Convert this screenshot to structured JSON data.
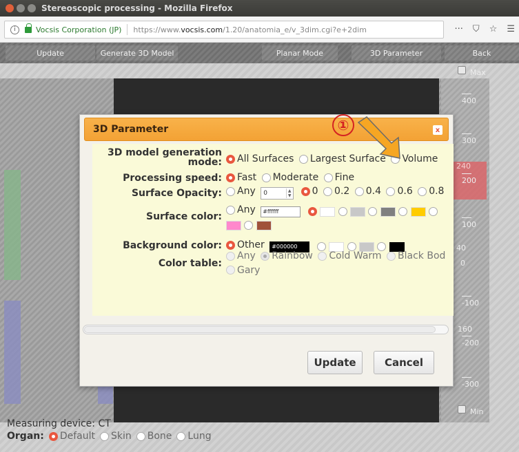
{
  "window": {
    "title": "Stereoscopic processing - Mozilla Firefox"
  },
  "urlbar": {
    "site_identity": "Vocsis Corporation (JP)",
    "url_prefix": "https://www.",
    "url_domain": "vocsis.com",
    "url_path": "/1.20/anatomia_e/v_3dim.cgi?e+2dim",
    "more_icon": "···"
  },
  "toolbar": {
    "update": "Update",
    "generate": "Generate 3D Model",
    "planar": "Planar Mode",
    "parameter": "3D Parameter",
    "back": "Back"
  },
  "ruler": {
    "max": "Max",
    "min": "Min",
    "labels": [
      "400",
      "300",
      "200",
      "100",
      "0",
      "-100",
      "-200",
      "-300"
    ],
    "side_labels": [
      "240",
      "40",
      "160"
    ]
  },
  "footer": {
    "measuring": "Measuring device: CT",
    "organ_label": "Organ:",
    "organs": [
      "Default",
      "Skin",
      "Bone",
      "Lung"
    ]
  },
  "annotation": {
    "number": "①"
  },
  "dialog": {
    "title": "3D Parameter",
    "close": "x",
    "generation": {
      "label_line1": "3D model generation",
      "label_line2": "mode:",
      "options": [
        "All Surfaces",
        "Largest Surface",
        "Volume"
      ]
    },
    "speed": {
      "label": "Processing speed:",
      "options": [
        "Fast",
        "Moderate",
        "Fine"
      ]
    },
    "opacity": {
      "label": "Surface Opacity:",
      "any": "Any",
      "input_value": "0",
      "options": [
        "0",
        "0.2",
        "0.4",
        "0.6",
        "0.8"
      ]
    },
    "surface_color": {
      "label": "Surface color:",
      "any": "Any",
      "input_value": "#ffffff",
      "swatches": [
        "#ffffff",
        "#c8c8c8",
        "#808080",
        "#ffcc00",
        "#ff88cc",
        "#a0523a"
      ]
    },
    "background_color": {
      "label": "Background color:",
      "other": "Other",
      "input_value": "#000000",
      "swatches": [
        "#ffffff",
        "#c8c8c8",
        "#000000"
      ]
    },
    "color_table": {
      "label": "Color table:",
      "options": [
        "Any",
        "Rainbow",
        "Cold Warm",
        "Black Bod",
        "Gary"
      ]
    },
    "update_button": "Update",
    "cancel_button": "Cancel"
  }
}
